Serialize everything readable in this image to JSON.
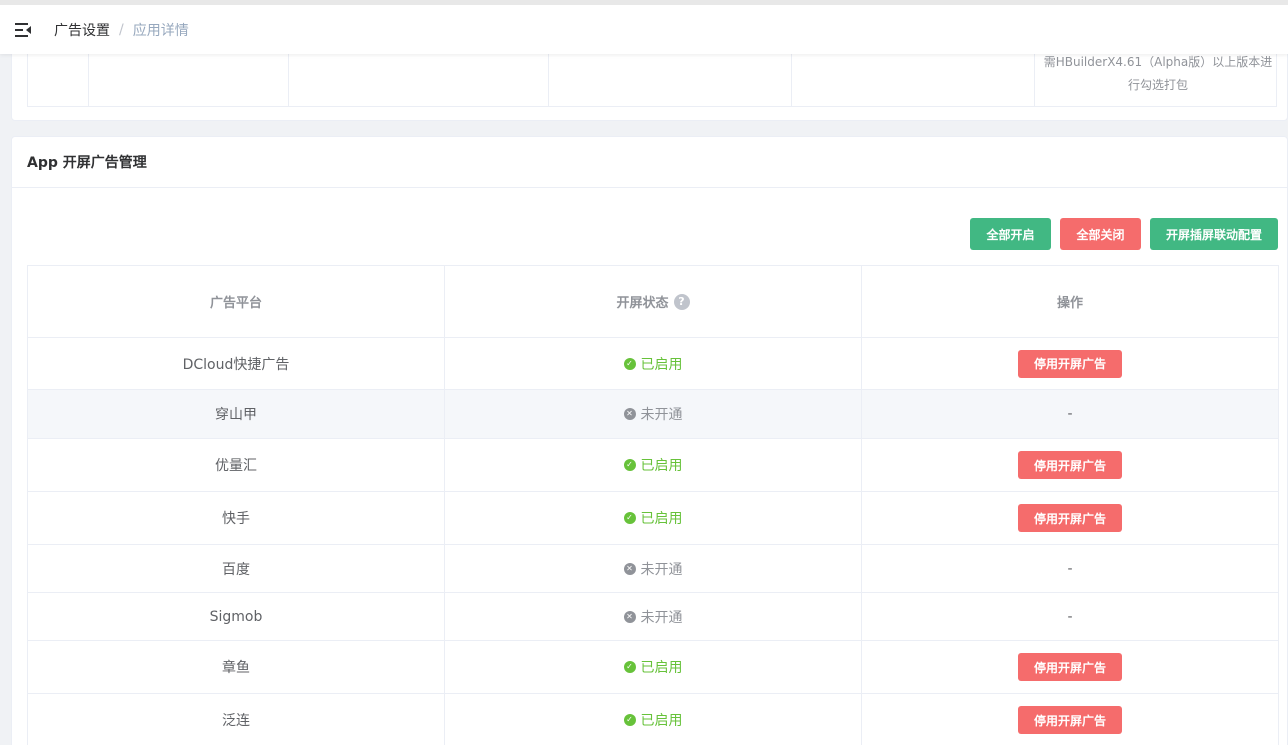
{
  "topbar": {
    "breadcrumb": [
      "广告设置",
      "应用详情"
    ],
    "separator": "/"
  },
  "top_card": {
    "note_line1": "需HBuilderX4.61（Alpha版）以上版本进",
    "note_line2": "行勾选打包"
  },
  "main_card": {
    "title": "App 开屏广告管理",
    "buttons": {
      "enable_all": "全部开启",
      "disable_all": "全部关闭",
      "linkage_config": "开屏插屏联动配置"
    },
    "table": {
      "headers": {
        "platform": "广告平台",
        "status": "开屏状态",
        "status_help": "?",
        "action": "操作"
      },
      "rows": [
        {
          "platform": "DCloud快捷广告",
          "status": "已启用",
          "enabled": true,
          "action": "停用开屏广告"
        },
        {
          "platform": "穿山甲",
          "status": "未开通",
          "enabled": false,
          "action": "-"
        },
        {
          "platform": "优量汇",
          "status": "已启用",
          "enabled": true,
          "action": "停用开屏广告"
        },
        {
          "platform": "快手",
          "status": "已启用",
          "enabled": true,
          "action": "停用开屏广告"
        },
        {
          "platform": "百度",
          "status": "未开通",
          "enabled": false,
          "action": "-"
        },
        {
          "platform": "Sigmob",
          "status": "未开通",
          "enabled": false,
          "action": "-"
        },
        {
          "platform": "章鱼",
          "status": "已启用",
          "enabled": true,
          "action": "停用开屏广告"
        },
        {
          "platform": "泛连",
          "status": "已启用",
          "enabled": true,
          "action": "停用开屏广告"
        }
      ]
    }
  },
  "colors": {
    "green": "#41b883",
    "red": "#f56c6c",
    "enabled": "#67c23a",
    "disabled": "#909399"
  }
}
